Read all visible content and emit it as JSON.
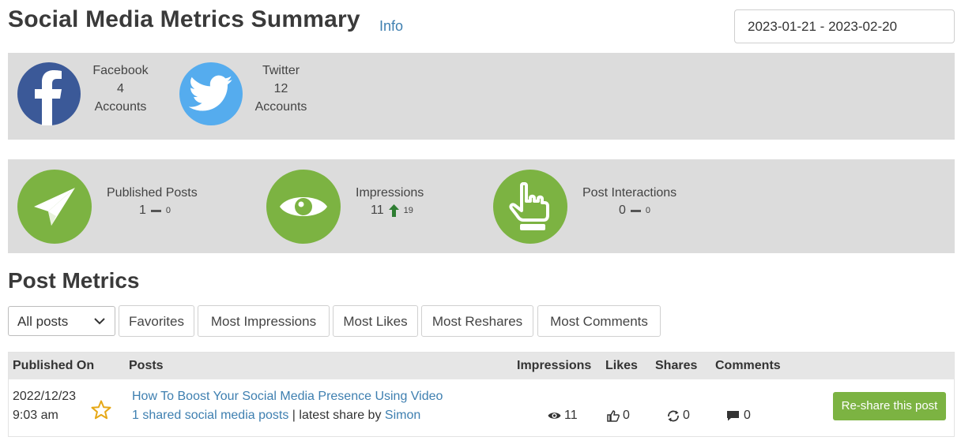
{
  "header": {
    "title": "Social Media Metrics Summary",
    "info_link": "Info",
    "date_range": "2023-01-21 - 2023-02-20"
  },
  "accounts": [
    {
      "network": "Facebook",
      "count": "4",
      "unit": "Accounts",
      "icon": "facebook-icon",
      "color": "#3b5998"
    },
    {
      "network": "Twitter",
      "count": "12",
      "unit": "Accounts",
      "icon": "twitter-icon",
      "color": "#55acee"
    }
  ],
  "stats": [
    {
      "label": "Published Posts",
      "value": "1",
      "change": "0",
      "trend": "flat",
      "icon": "paper-plane-icon"
    },
    {
      "label": "Impressions",
      "value": "11",
      "change": "19",
      "trend": "up",
      "icon": "eye-icon"
    },
    {
      "label": "Post Interactions",
      "value": "0",
      "change": "0",
      "trend": "flat",
      "icon": "hand-pointer-icon"
    }
  ],
  "colors": {
    "accent_green": "#7cb342",
    "link_blue": "#3e7fb0",
    "panel_gray": "#dcdcdc"
  },
  "post_metrics": {
    "title": "Post Metrics",
    "filter_select": "All posts",
    "filter_buttons": [
      "Favorites",
      "Most Impressions",
      "Most Likes",
      "Most Reshares",
      "Most Comments"
    ],
    "columns": [
      "Published On",
      "Posts",
      "Impressions",
      "Likes",
      "Shares",
      "Comments"
    ],
    "rows": [
      {
        "date": "2022/12/23",
        "time": "9:03 am",
        "title": "How To Boost Your Social Media Presence Using Video",
        "shared_text": "1 shared social media posts",
        "separator": "|",
        "latest_share_prefix": "latest share by",
        "latest_share_user": "Simon",
        "impressions": "11",
        "likes": "0",
        "shares": "0",
        "comments": "0",
        "action": "Re-share this post"
      }
    ]
  }
}
